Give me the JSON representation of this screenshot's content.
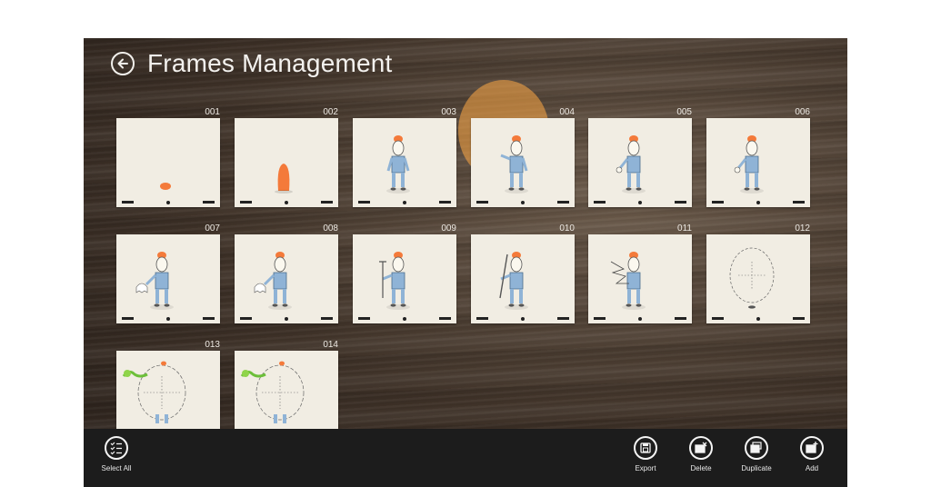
{
  "header": {
    "title": "Frames Management",
    "back_icon": "back-arrow-icon"
  },
  "frames": [
    {
      "number": "001",
      "content": "hat-icon"
    },
    {
      "number": "002",
      "content": "blob-icon"
    },
    {
      "number": "003",
      "content": "character-standing-icon"
    },
    {
      "number": "004",
      "content": "character-pointing-icon"
    },
    {
      "number": "005",
      "content": "character-hand-icon"
    },
    {
      "number": "006",
      "content": "character-hand-icon"
    },
    {
      "number": "007",
      "content": "character-ghost-icon"
    },
    {
      "number": "008",
      "content": "character-ghost-icon"
    },
    {
      "number": "009",
      "content": "character-hammer-icon"
    },
    {
      "number": "010",
      "content": "character-stick-icon"
    },
    {
      "number": "011",
      "content": "character-splash-icon"
    },
    {
      "number": "012",
      "content": "circle-face-icon"
    },
    {
      "number": "013",
      "content": "character-bird-icon"
    },
    {
      "number": "014",
      "content": "character-bird-icon"
    }
  ],
  "appbar": {
    "select_all": "Select All",
    "export": "Export",
    "delete": "Delete",
    "duplicate": "Duplicate",
    "add": "Add"
  },
  "colors": {
    "accent": "#f47a3a",
    "body_blue": "#8fb3d6",
    "highlight": "#ffaa46"
  }
}
